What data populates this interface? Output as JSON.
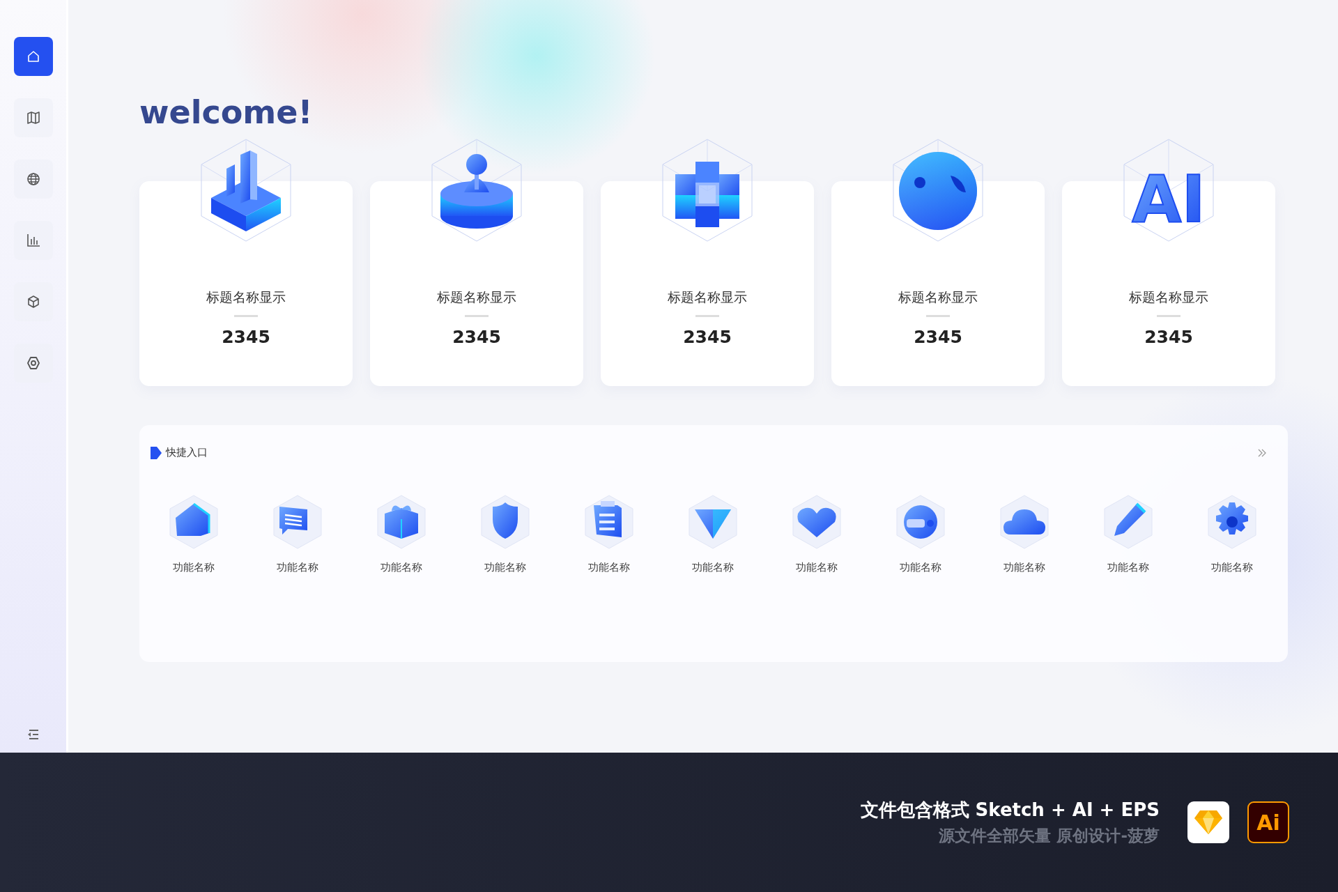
{
  "sidebar": {
    "items": [
      {
        "kind": "home",
        "selected": true
      },
      {
        "kind": "map",
        "selected": false
      },
      {
        "kind": "globe",
        "selected": false
      },
      {
        "kind": "chart",
        "selected": false
      },
      {
        "kind": "cube",
        "selected": false
      },
      {
        "kind": "settings",
        "selected": false
      }
    ]
  },
  "welcome": "welcome!",
  "stats": [
    {
      "kind": "bars",
      "title": "标题名称显示",
      "value": "2345"
    },
    {
      "kind": "database",
      "title": "标题名称显示",
      "value": "2345"
    },
    {
      "kind": "blocks",
      "title": "标题名称显示",
      "value": "2345"
    },
    {
      "kind": "sphere",
      "title": "标题名称显示",
      "value": "2345"
    },
    {
      "kind": "ai",
      "title": "标题名称显示",
      "value": "2345",
      "text": "AI"
    }
  ],
  "quick_access": {
    "title": "快捷入口",
    "items": [
      {
        "kind": "house",
        "label": "功能名称"
      },
      {
        "kind": "message",
        "label": "功能名称"
      },
      {
        "kind": "gift",
        "label": "功能名称"
      },
      {
        "kind": "shield",
        "label": "功能名称"
      },
      {
        "kind": "clipboard",
        "label": "功能名称"
      },
      {
        "kind": "vee",
        "label": "功能名称"
      },
      {
        "kind": "heart",
        "label": "功能名称"
      },
      {
        "kind": "helmet",
        "label": "功能名称"
      },
      {
        "kind": "cloud",
        "label": "功能名称"
      },
      {
        "kind": "pencil",
        "label": "功能名称"
      },
      {
        "kind": "gear",
        "label": "功能名称"
      }
    ]
  },
  "promo": {
    "headline": "文件包含格式 Sketch + AI + EPS",
    "subline": "源文件全部矢量 原创设计-菠萝",
    "badges": [
      {
        "kind": "sketch"
      },
      {
        "kind": "illustrator",
        "text": "Ai"
      }
    ]
  }
}
